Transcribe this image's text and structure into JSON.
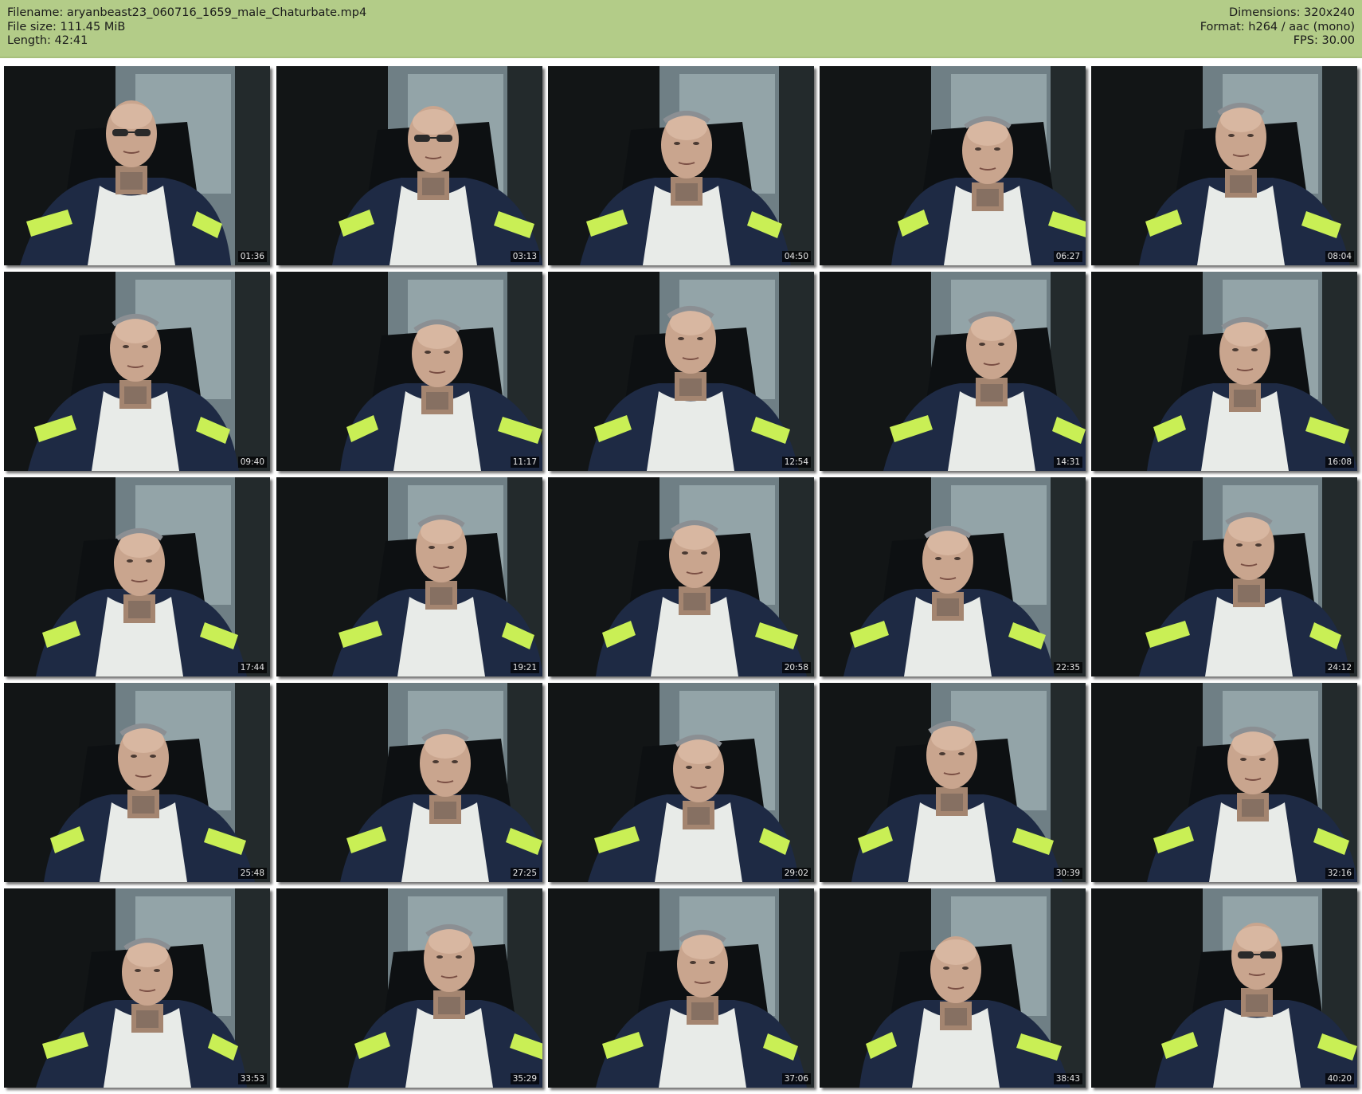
{
  "header": {
    "filename_label": "Filename: aryanbeast23_060716_1659_male_Chaturbate.mp4",
    "filesize_label": "File size: 111.45 MiB",
    "length_label": "Length: 42:41",
    "dimensions_label": "Dimensions: 320x240",
    "format_label": "Format: h264 / aac (mono)",
    "fps_label": "FPS: 30.00"
  },
  "thumbnails": [
    {
      "timestamp": "01:36",
      "glasses": "dark"
    },
    {
      "timestamp": "03:13",
      "glasses": "dark"
    },
    {
      "timestamp": "04:50",
      "glasses": "head"
    },
    {
      "timestamp": "06:27",
      "glasses": "head"
    },
    {
      "timestamp": "08:04",
      "glasses": "head"
    },
    {
      "timestamp": "09:40",
      "glasses": "head"
    },
    {
      "timestamp": "11:17",
      "glasses": "head"
    },
    {
      "timestamp": "12:54",
      "glasses": "head"
    },
    {
      "timestamp": "14:31",
      "glasses": "head"
    },
    {
      "timestamp": "16:08",
      "glasses": "head"
    },
    {
      "timestamp": "17:44",
      "glasses": "head"
    },
    {
      "timestamp": "19:21",
      "glasses": "head"
    },
    {
      "timestamp": "20:58",
      "glasses": "head"
    },
    {
      "timestamp": "22:35",
      "glasses": "head"
    },
    {
      "timestamp": "24:12",
      "glasses": "head"
    },
    {
      "timestamp": "25:48",
      "glasses": "head"
    },
    {
      "timestamp": "27:25",
      "glasses": "head"
    },
    {
      "timestamp": "29:02",
      "glasses": "head"
    },
    {
      "timestamp": "30:39",
      "glasses": "head"
    },
    {
      "timestamp": "32:16",
      "glasses": "head"
    },
    {
      "timestamp": "33:53",
      "glasses": "head"
    },
    {
      "timestamp": "35:29",
      "glasses": "head"
    },
    {
      "timestamp": "37:06",
      "glasses": "head"
    },
    {
      "timestamp": "38:43",
      "glasses": "none"
    },
    {
      "timestamp": "40:20",
      "glasses": "dark"
    }
  ],
  "colors": {
    "header_bg": "#b3cc88",
    "shirt": "#1e2a44",
    "stripe": "#c9ef55",
    "tanktop": "#e8ebe8",
    "skin": "#c9a58e"
  }
}
